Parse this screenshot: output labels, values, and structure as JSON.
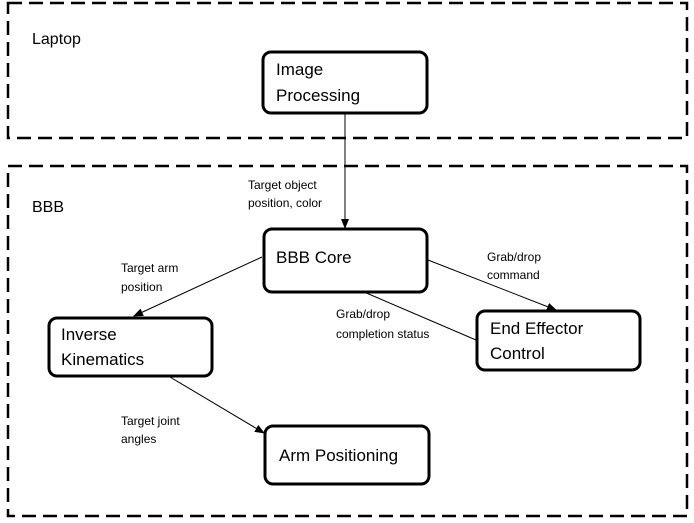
{
  "zones": [
    {
      "id": "laptop",
      "label": "Laptop"
    },
    {
      "id": "bbb",
      "label": "BBB"
    }
  ],
  "nodes": [
    {
      "id": "image-processing",
      "lines": [
        "Image",
        "Processing"
      ]
    },
    {
      "id": "bbb-core",
      "lines": [
        "BBB Core"
      ]
    },
    {
      "id": "inverse-kinematics",
      "lines": [
        "Inverse",
        "Kinematics"
      ]
    },
    {
      "id": "end-effector-control",
      "lines": [
        "End Effector",
        "Control"
      ]
    },
    {
      "id": "arm-positioning",
      "lines": [
        "Arm Positioning"
      ]
    }
  ],
  "edges": [
    {
      "from": "image-processing",
      "to": "bbb-core",
      "lines": [
        "Target object",
        "position, color"
      ]
    },
    {
      "from": "bbb-core",
      "to": "inverse-kinematics",
      "lines": [
        "Target arm",
        "position"
      ]
    },
    {
      "from": "bbb-core",
      "to": "end-effector-control",
      "lines": [
        "Grab/drop",
        "command"
      ]
    },
    {
      "from": "end-effector-control",
      "to": "bbb-core",
      "lines": [
        "Grab/drop",
        "completion status"
      ]
    },
    {
      "from": "inverse-kinematics",
      "to": "arm-positioning",
      "lines": [
        "Target joint",
        "angles"
      ]
    }
  ]
}
